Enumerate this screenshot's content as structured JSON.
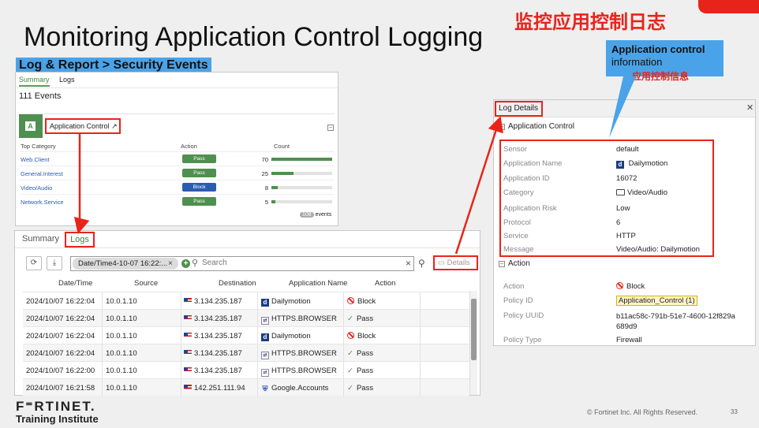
{
  "slide": {
    "title": "Monitoring Application Control Logging",
    "title_cn": "监控应用控制日志",
    "breadcrumb": "Log & Report > Security Events",
    "footer_brand": "F⁼RTINET.",
    "footer_sub": "Training Institute",
    "copyright": "© Fortinet Inc. All Rights Reserved.",
    "page_number": "33",
    "accent_color": "#e8241a",
    "callout_color": "#4aa3e8"
  },
  "callout": {
    "line1": "Application control",
    "line2": "information",
    "line3_cn": "应用控制信息"
  },
  "summary_panel": {
    "tabs": [
      "Summary",
      "Logs"
    ],
    "events": "111 Events",
    "card_icon_letter": "A",
    "card_title": "Application Control",
    "headers": {
      "category": "Top Category",
      "action": "Action",
      "count": "Count"
    },
    "rows": [
      {
        "category": "Web.Client",
        "action": "Pass",
        "count": "70",
        "bar_fraction": 1.0,
        "color": "#4f8f4f"
      },
      {
        "category": "General.Interest",
        "action": "Pass",
        "count": "25",
        "bar_fraction": 0.36,
        "color": "#4f8f4f"
      },
      {
        "category": "Video/Audio",
        "action": "Block",
        "count": "8",
        "bar_fraction": 0.11,
        "color": "#2a5db0"
      },
      {
        "category": "Network.Service",
        "action": "Pass",
        "count": "5",
        "bar_fraction": 0.07,
        "color": "#4f8f4f"
      }
    ],
    "footer_count": "108",
    "footer_label": "events"
  },
  "logs_panel": {
    "tabs": [
      "Summary",
      "Logs"
    ],
    "filter_chip": "Date/Time4-10-07 16:22:...",
    "search_placeholder": "Search",
    "details_label": "Details",
    "columns": [
      "Date/Time",
      "Source",
      "Destination",
      "Application Name",
      "Action"
    ],
    "rows": [
      {
        "time": "2024/10/07 16:22:04",
        "source": "10.0.1.10",
        "dest": "3.134.235.187",
        "app": "Dailymotion",
        "app_icon": "d",
        "action": "Block"
      },
      {
        "time": "2024/10/07 16:22:04",
        "source": "10.0.1.10",
        "dest": "3.134.235.187",
        "app": "HTTPS.BROWSER",
        "app_icon": "h",
        "action": "Pass"
      },
      {
        "time": "2024/10/07 16:22:04",
        "source": "10.0.1.10",
        "dest": "3.134.235.187",
        "app": "Dailymotion",
        "app_icon": "d",
        "action": "Block"
      },
      {
        "time": "2024/10/07 16:22:04",
        "source": "10.0.1.10",
        "dest": "3.134.235.187",
        "app": "HTTPS.BROWSER",
        "app_icon": "h",
        "action": "Pass"
      },
      {
        "time": "2024/10/07 16:22:00",
        "source": "10.0.1.10",
        "dest": "3.134.235.187",
        "app": "HTTPS.BROWSER",
        "app_icon": "h",
        "action": "Pass"
      },
      {
        "time": "2024/10/07 16:21:58",
        "source": "10.0.1.10",
        "dest": "142.251.111.94",
        "app": "Google.Accounts",
        "app_icon": "g",
        "action": "Pass"
      }
    ]
  },
  "details_panel": {
    "title": "Log Details",
    "section_app": "Application Control",
    "section_action": "Action",
    "app_fields": [
      {
        "label": "Sensor",
        "value": "default"
      },
      {
        "label": "Application Name",
        "value": "Dailymotion"
      },
      {
        "label": "Application ID",
        "value": "16072"
      },
      {
        "label": "Category",
        "value": "Video/Audio"
      },
      {
        "label": "Application Risk",
        "value": "Low"
      },
      {
        "label": "Protocol",
        "value": "6"
      },
      {
        "label": "Service",
        "value": "HTTP"
      },
      {
        "label": "Message",
        "value": "Video/Audio: Dailymotion"
      }
    ],
    "action_fields": [
      {
        "label": "Action",
        "value": "Block"
      },
      {
        "label": "Policy ID",
        "value": "Application_Control (1)"
      },
      {
        "label": "Policy UUID",
        "value": "b11ac58c-791b-51e7-4600-12f829a",
        "value2": "689d9"
      },
      {
        "label": "Policy Type",
        "value": "Firewall"
      }
    ]
  }
}
